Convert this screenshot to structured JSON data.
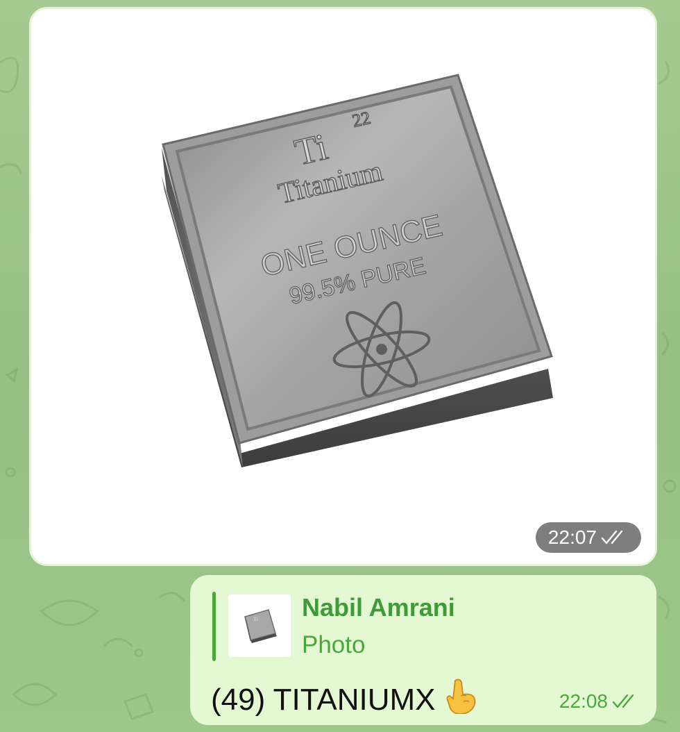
{
  "photo_message": {
    "time": "22:07",
    "status": "read",
    "photo": {
      "engraving_symbol": "Ti",
      "engraving_number": "22",
      "engraving_name": "Titanium",
      "engraving_weight": "ONE OUNCE",
      "engraving_purity": "99.5% PURE"
    }
  },
  "reply_message": {
    "quote": {
      "author": "Nabil Amrani",
      "type": "Photo"
    },
    "text": "(49) TITANIUMX",
    "emoji": "backhand-index-pointing-up",
    "time": "22:08",
    "status": "read"
  },
  "colors": {
    "accent_green": "#4aa83a",
    "bubble_out": "#e4f8d4",
    "wallpaper": "#9bc38a"
  }
}
